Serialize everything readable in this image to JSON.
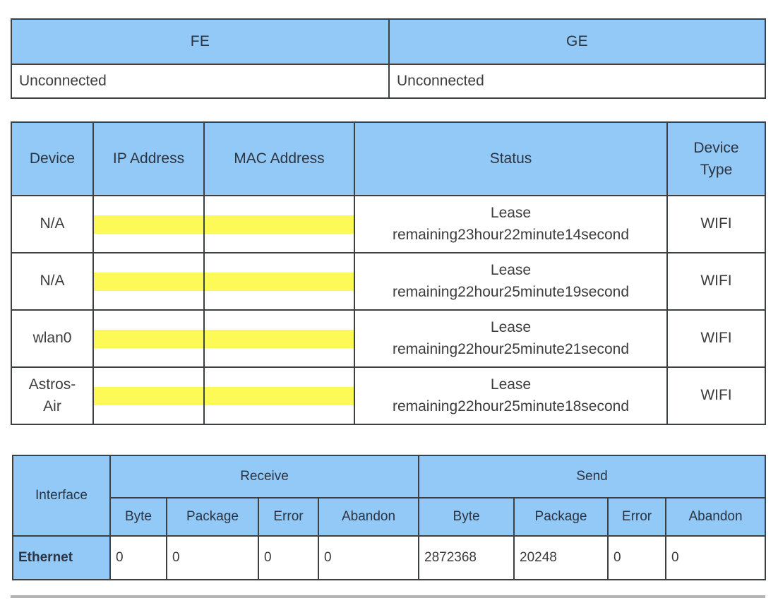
{
  "link_status_table": {
    "name": "wan-link-status",
    "headers": [
      "FE",
      "GE"
    ],
    "rows": [
      [
        "Unconnected",
        "Unconnected"
      ]
    ]
  },
  "client_table": {
    "name": "dhcp-client-list",
    "headers": [
      "Device",
      "IP Address",
      "MAC Address",
      "Status",
      "Device Type"
    ],
    "device_type_header_line1": "Device",
    "device_type_header_line2": "Type",
    "redacted_placeholder": "",
    "rows": [
      {
        "device": "N/A",
        "ip_address": "",
        "mac_address": "",
        "status_line1": "Lease",
        "status_line2": "remaining23hour22minute14second",
        "device_type": "WIFI"
      },
      {
        "device": "N/A",
        "ip_address": "",
        "mac_address": "",
        "status_line1": "Lease",
        "status_line2": "remaining22hour25minute19second",
        "device_type": "WIFI"
      },
      {
        "device": "wlan0",
        "ip_address": "",
        "mac_address": "",
        "status_line1": "Lease",
        "status_line2": "remaining22hour25minute21second",
        "device_type": "WIFI"
      },
      {
        "device": "Astros-Air",
        "device_line1": "Astros-",
        "device_line2": "Air",
        "ip_address": "",
        "mac_address": "",
        "status_line1": "Lease",
        "status_line2": "remaining22hour25minute18second",
        "device_type": "WIFI"
      }
    ]
  },
  "counter_table": {
    "name": "interface-statistics",
    "group_headers": {
      "interface": "Interface",
      "receive": "Receive",
      "send": "Send"
    },
    "sub_headers": {
      "receive": [
        "Byte",
        "Package",
        "Error",
        "Abandon"
      ],
      "send": [
        "Byte",
        "Package",
        "Error",
        "Abandon"
      ]
    },
    "rows": [
      {
        "interface": "Ethernet",
        "receive": [
          "0",
          "0",
          "0",
          "0"
        ],
        "send": [
          "2872368",
          "20248",
          "0",
          "0"
        ]
      }
    ]
  },
  "colors": {
    "header_blue": "#93c9f7",
    "redaction_yellow": "#fdf957",
    "border": "#3c4043",
    "header_text": "#2b3440",
    "body_text": "#3c3c3c"
  }
}
